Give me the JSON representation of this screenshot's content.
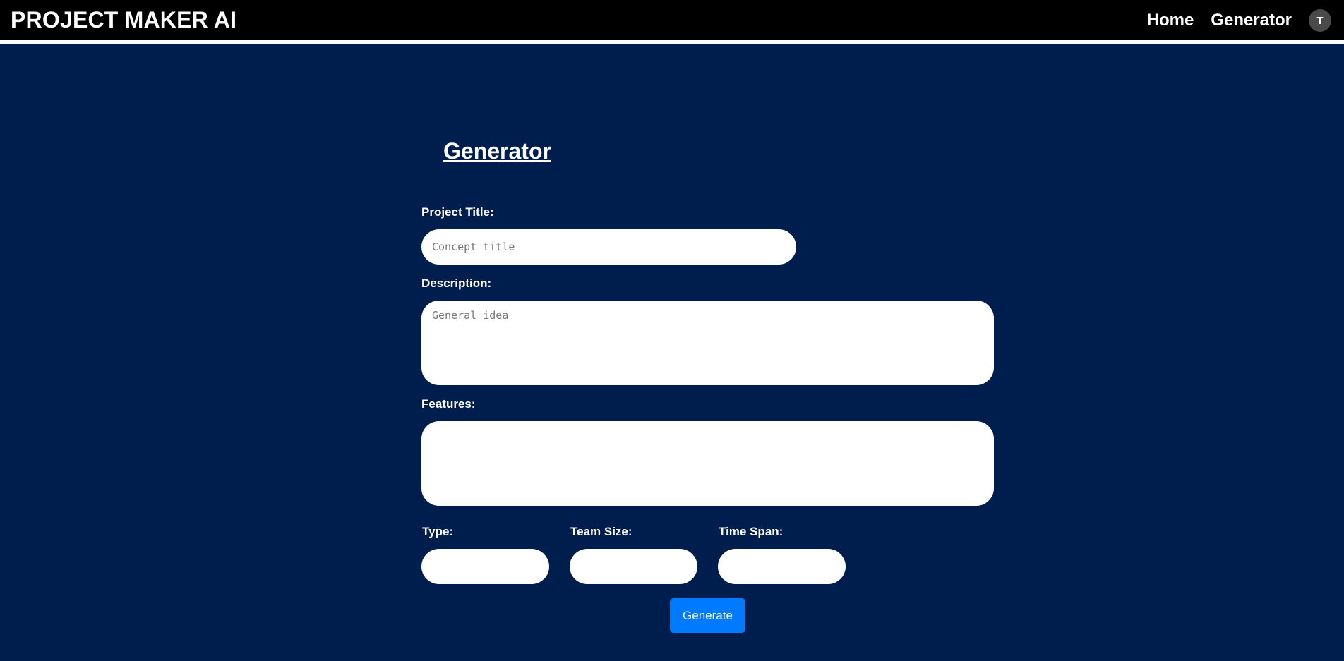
{
  "navbar": {
    "brand": "PROJECT MAKER AI",
    "links": [
      "Home",
      "Generator"
    ],
    "avatar_initial": "T"
  },
  "main": {
    "title": "Generator",
    "project_title": {
      "label": "Project Title:",
      "placeholder": "Concept title",
      "value": ""
    },
    "description": {
      "label": "Description:",
      "placeholder": "General idea",
      "value": ""
    },
    "features": {
      "label": "Features:",
      "placeholder": "",
      "value": ""
    },
    "type": {
      "label": "Type:",
      "value": ""
    },
    "team_size": {
      "label": "Team Size:",
      "value": ""
    },
    "time_span": {
      "label": "Time Span:",
      "value": ""
    },
    "generate_label": "Generate"
  },
  "colors": {
    "background": "#001e4d",
    "navbar": "#000000",
    "button": "#007bff"
  }
}
